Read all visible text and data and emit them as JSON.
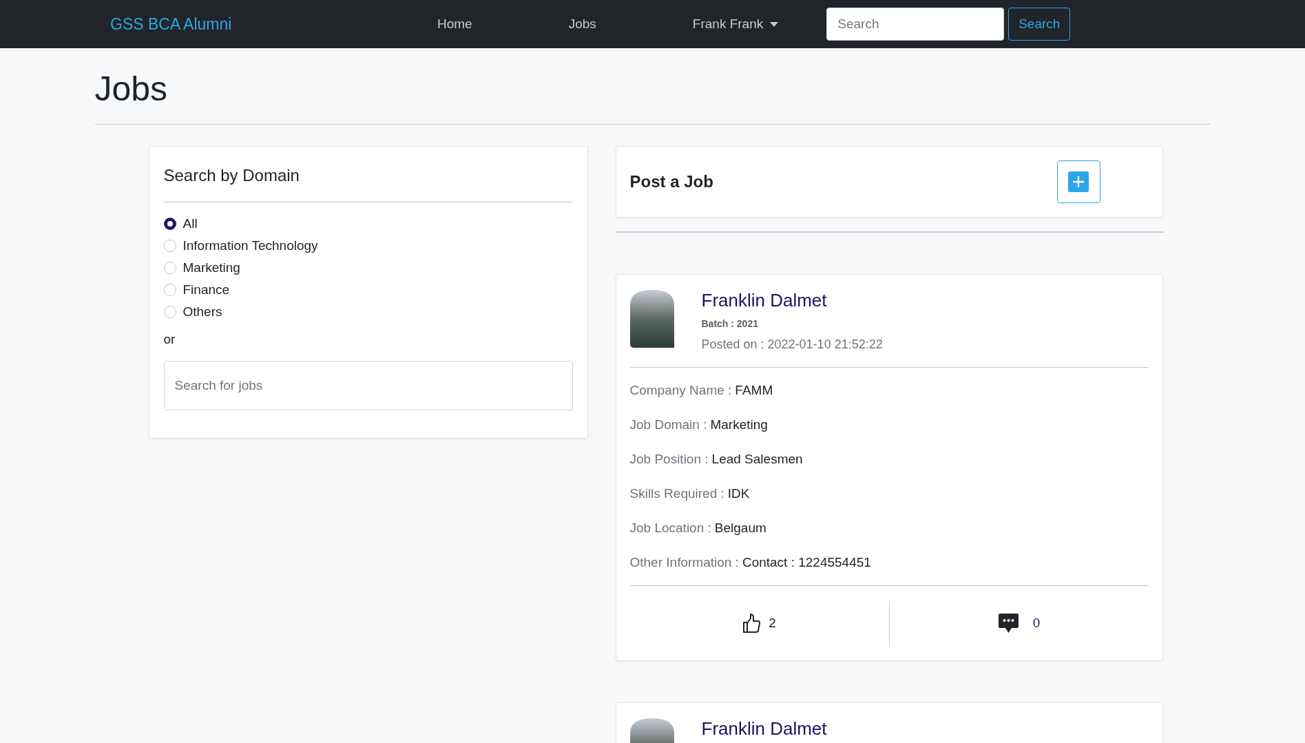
{
  "navbar": {
    "brand": "GSS BCA Alumni",
    "links": [
      {
        "label": "Home"
      },
      {
        "label": "Jobs"
      }
    ],
    "user_menu": {
      "label": "Frank Frank"
    },
    "search": {
      "placeholder": "Search"
    },
    "search_button": "Search"
  },
  "page_title": "Jobs",
  "filter": {
    "title": "Search by Domain",
    "options": [
      {
        "label": "All",
        "selected": true
      },
      {
        "label": "Information Technology",
        "selected": false
      },
      {
        "label": "Marketing",
        "selected": false
      },
      {
        "label": "Finance",
        "selected": false
      },
      {
        "label": "Others",
        "selected": false
      }
    ],
    "or_text": "or",
    "search": {
      "placeholder": "Search for jobs"
    }
  },
  "post_job": {
    "title": "Post a Job"
  },
  "jobs": [
    {
      "author": "Franklin Dalmet",
      "batch": "Batch : 2021",
      "posted": "Posted on : 2022-01-10 21:52:22",
      "fields": [
        {
          "label": "Company Name :",
          "value": "FAMM"
        },
        {
          "label": "Job Domain :",
          "value": "Marketing"
        },
        {
          "label": "Job Position :",
          "value": "Lead Salesmen"
        },
        {
          "label": "Skills Required :",
          "value": "IDK"
        },
        {
          "label": "Job Location :",
          "value": "Belgaum"
        },
        {
          "label": "Other Information :",
          "value": "Contact : 1224554451"
        }
      ],
      "likes": "2",
      "comments": "0"
    },
    {
      "author": "Franklin Dalmet"
    }
  ]
}
